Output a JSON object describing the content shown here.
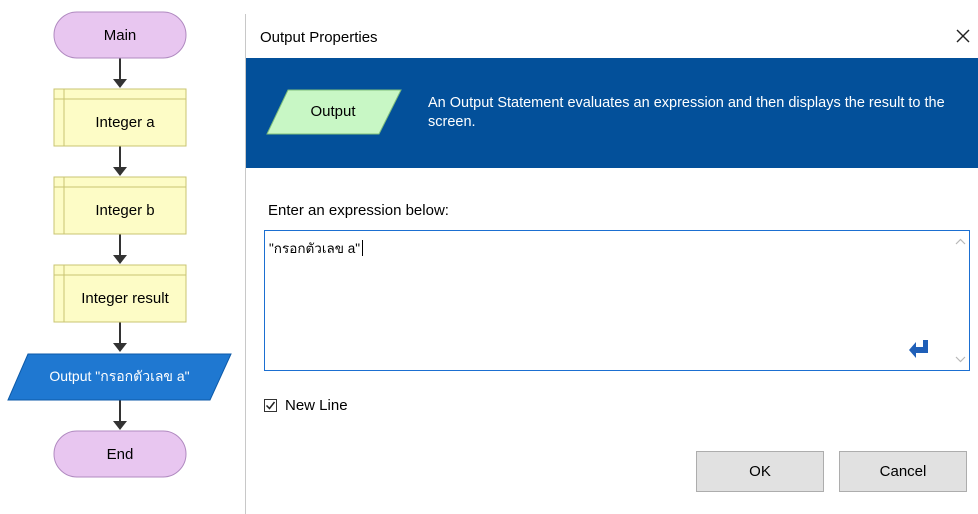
{
  "flowchart": {
    "nodes": [
      {
        "kind": "terminal",
        "label": "Main"
      },
      {
        "kind": "declare",
        "label": "Integer a"
      },
      {
        "kind": "declare",
        "label": "Integer b"
      },
      {
        "kind": "declare",
        "label": "Integer result"
      },
      {
        "kind": "output",
        "label": "Output \"กรอกตัวเลข a\""
      },
      {
        "kind": "terminal",
        "label": "End"
      }
    ],
    "colors": {
      "terminal": "#e8c6f0",
      "declare": "#fdfcc6",
      "output": "#1f78d1",
      "connector": "#333333"
    }
  },
  "dialog": {
    "title": "Output Properties",
    "close_icon": "close-icon",
    "banner": {
      "shape_label": "Output",
      "description": "An Output Statement evaluates an expression and then displays the result to the screen.",
      "background": "#03509a",
      "shape_color": "#c8f7c5"
    },
    "prompt": "Enter an expression below:",
    "expression": "\"กรอกตัวเลข a\"",
    "enter_icon": "enter-icon",
    "new_line": {
      "label": "New Line",
      "checked": true
    },
    "buttons": {
      "ok": "OK",
      "cancel": "Cancel"
    }
  }
}
